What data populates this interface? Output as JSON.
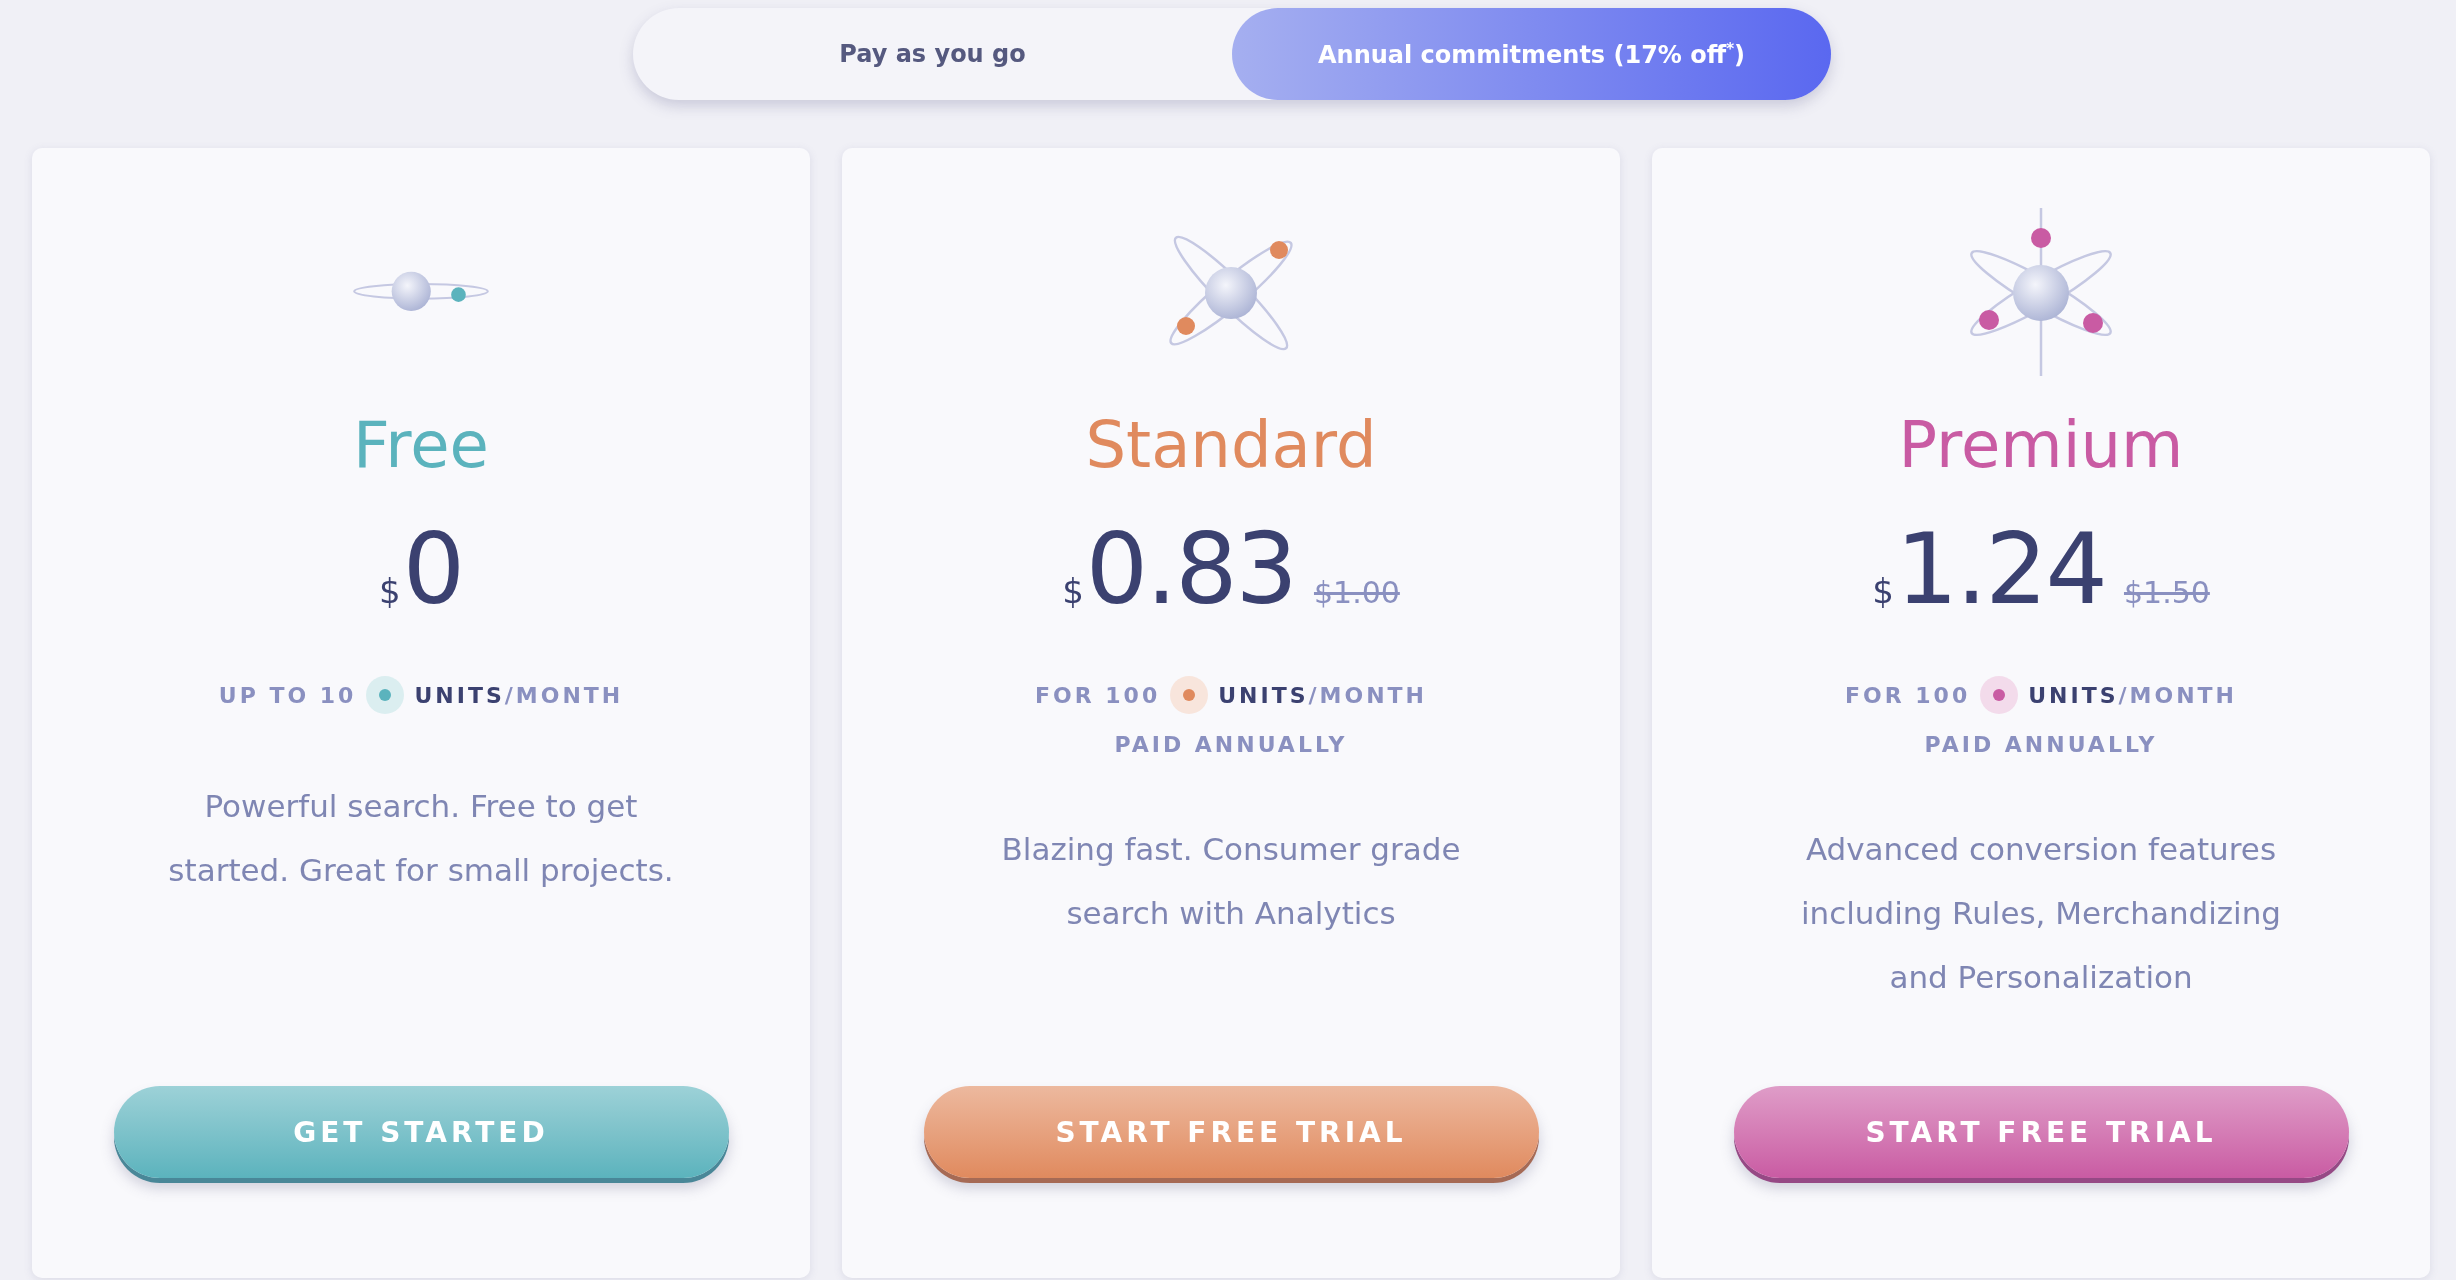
{
  "billing_toggle": [
    {
      "label": "Pay as you go",
      "selected": false
    },
    {
      "label": "Annual commitments (17% off$^{*}$)",
      "selected": true
    }
  ],
  "plans": [
    {
      "kind": "single-orbit",
      "name": "Free",
      "color": "#5bb3bd",
      "currency": "$",
      "price": "0",
      "units_prefix": "UP TO 10",
      "units": "UNITS",
      "per": "/MONTH",
      "description": "Powerful search. Free to get started. Great for small projects.",
      "button": "GET STARTED"
    },
    {
      "kind": "double-orbit",
      "name": "Standard",
      "color": "#e08a5e",
      "currency": "$",
      "price": "0.83",
      "old_price": "$1.00",
      "units_prefix": "FOR 100",
      "units": "UNITS",
      "per": "/MONTH",
      "billing": "PAID ANNUALLY",
      "description": "Blazing fast. Consumer grade search with Analytics",
      "button": "START FREE TRIAL"
    },
    {
      "kind": "triple-orbit",
      "name": "Premium",
      "color": "#c95ba3",
      "currency": "$",
      "price": "1.24",
      "old_price": "$1.50",
      "units_prefix": "FOR 100",
      "units": "UNITS",
      "per": "/MONTH",
      "billing": "PAID ANNUALLY",
      "description": "Advanced conversion features including Rules, Merchandizing and Personalization",
      "button": "START FREE TRIAL"
    }
  ]
}
